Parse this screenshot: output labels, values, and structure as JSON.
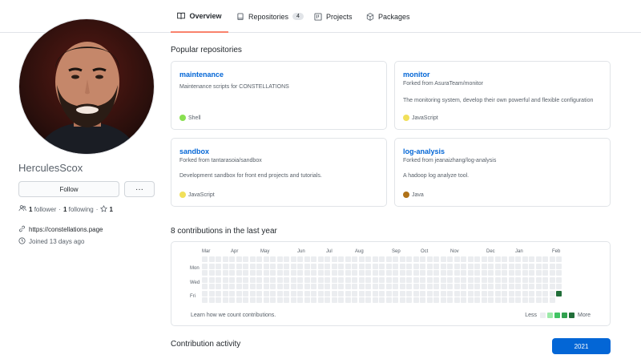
{
  "tabs": [
    {
      "label": "Overview",
      "icon": "book-icon",
      "active": true
    },
    {
      "label": "Repositories",
      "icon": "repo-icon",
      "count": "4"
    },
    {
      "label": "Projects",
      "icon": "project-icon"
    },
    {
      "label": "Packages",
      "icon": "package-icon"
    }
  ],
  "profile": {
    "username": "HerculesScox",
    "follow_label": "Follow",
    "more_label": "···",
    "followers_count": "1",
    "followers_label": "follower",
    "following_count": "1",
    "following_label": "following",
    "stars_count": "1",
    "website": "https://constellations.page",
    "joined": "Joined 13 days ago"
  },
  "popular": {
    "heading": "Popular repositories",
    "repos": [
      {
        "name": "maintenance",
        "fork": "",
        "desc": "Maintenance scripts for CONSTELLATIONS",
        "lang": "Shell",
        "lang_color": "#89e051"
      },
      {
        "name": "monitor",
        "fork": "Forked from AsuraTeam/monitor",
        "desc": "The monitoring system, develop their own powerful and flexible configuration",
        "lang": "JavaScript",
        "lang_color": "#f1e05a"
      },
      {
        "name": "sandbox",
        "fork": "Forked from tantarasoia/sandbox",
        "desc": "Development sandbox for front end projects and tutorials.",
        "lang": "JavaScript",
        "lang_color": "#f1e05a"
      },
      {
        "name": "log-analysis",
        "fork": "Forked from jeanaizhang/log-analysis",
        "desc": "A hadoop log analyze tool.",
        "lang": "Java",
        "lang_color": "#b07219"
      }
    ]
  },
  "contributions": {
    "heading": "8 contributions in the last year",
    "months": [
      "Mar",
      "Apr",
      "May",
      "Jun",
      "Jul",
      "Aug",
      "Sep",
      "Oct",
      "Nov",
      "Dec",
      "Jan",
      "Feb"
    ],
    "days": [
      "Mon",
      "Wed",
      "Fri"
    ],
    "weeks": 53,
    "empty_color": "#ebedf0",
    "level_colors": [
      "#ebedf0",
      "#9be9a8",
      "#40c463",
      "#30a14e",
      "#216e39"
    ],
    "last_week_days": 6,
    "active_cells": [
      {
        "week": 52,
        "day": 5,
        "level": 4
      }
    ],
    "learn_link": "Learn how we count contributions.",
    "less_label": "Less",
    "more_label": "More"
  },
  "activity": {
    "heading": "Contribution activity",
    "year": "2021",
    "accent": "#0366d6"
  }
}
